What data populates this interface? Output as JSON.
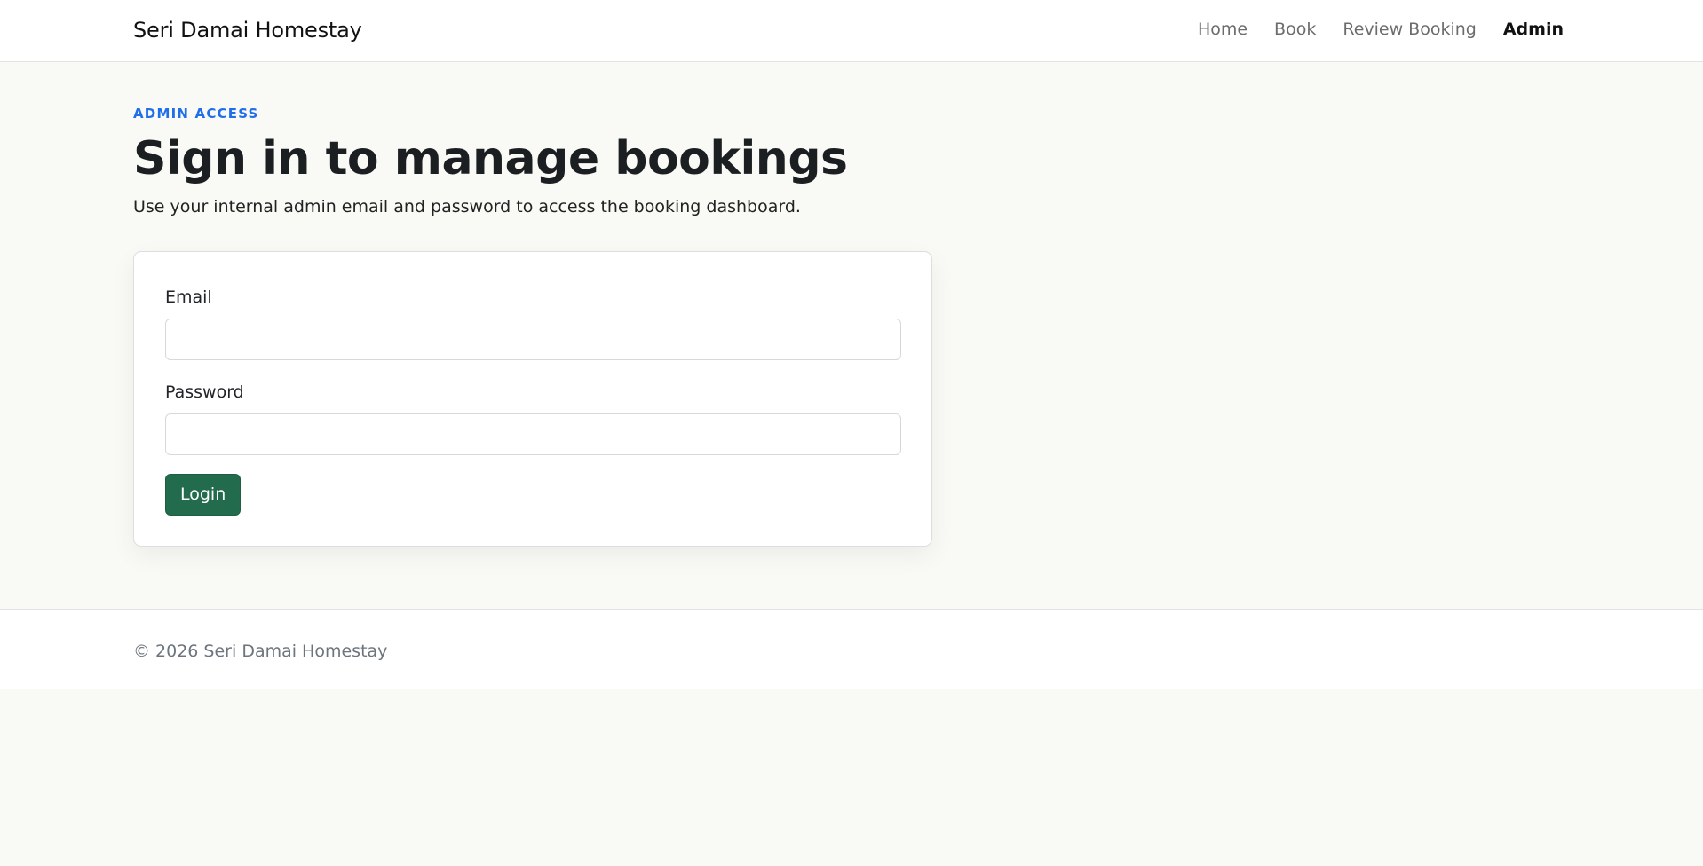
{
  "header": {
    "brand": "Seri Damai Homestay",
    "nav": [
      {
        "label": "Home",
        "active": false
      },
      {
        "label": "Book",
        "active": false
      },
      {
        "label": "Review Booking",
        "active": false
      },
      {
        "label": "Admin",
        "active": true
      }
    ]
  },
  "main": {
    "eyebrow": "ADMIN ACCESS",
    "title": "Sign in to manage bookings",
    "subtitle": "Use your internal admin email and password to access the booking dashboard."
  },
  "form": {
    "email_label": "Email",
    "email_value": "",
    "password_label": "Password",
    "password_value": "",
    "submit_label": "Login"
  },
  "footer": {
    "copyright": "© 2026 Seri Damai Homestay"
  },
  "colors": {
    "accent": "#1f6feb",
    "primary_button": "#226b4c",
    "background": "#f9f9f5"
  }
}
